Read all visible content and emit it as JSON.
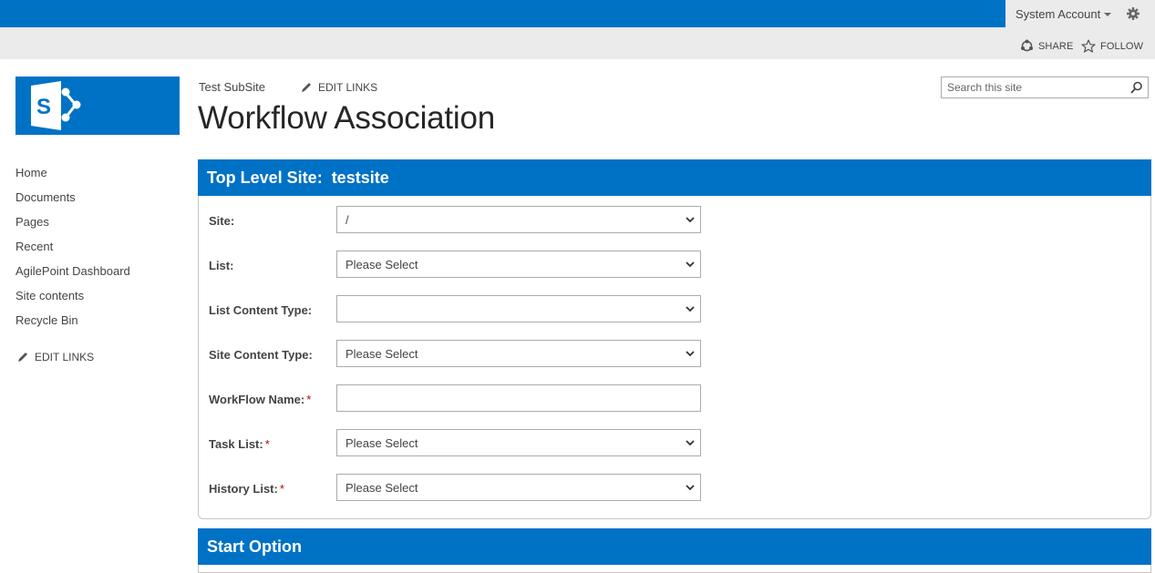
{
  "suite_bar": {
    "account_name": "System Account",
    "accent_color": "#0072c6"
  },
  "ribbon": {
    "share_label": "SHARE",
    "follow_label": "FOLLOW"
  },
  "header": {
    "site_link": "Test SubSite",
    "edit_links_label": "EDIT LINKS",
    "page_title": "Workflow Association",
    "search_placeholder": "Search this site"
  },
  "quick_launch": {
    "items": [
      {
        "label": "Home"
      },
      {
        "label": "Documents"
      },
      {
        "label": "Pages"
      },
      {
        "label": "Recent"
      },
      {
        "label": "AgilePoint Dashboard"
      },
      {
        "label": "Site contents"
      },
      {
        "label": "Recycle Bin"
      }
    ],
    "edit_links_label": "EDIT LINKS"
  },
  "association_panel": {
    "header_label": "Top Level Site:",
    "header_value": "testsite",
    "fields": [
      {
        "label": "Site:",
        "required": false,
        "type": "select",
        "value": "/"
      },
      {
        "label": "List:",
        "required": false,
        "type": "select",
        "value": "Please Select"
      },
      {
        "label": "List Content Type:",
        "required": false,
        "type": "select",
        "value": ""
      },
      {
        "label": "Site Content Type:",
        "required": false,
        "type": "select",
        "value": "Please Select"
      },
      {
        "label": "WorkFlow Name:",
        "required": true,
        "type": "text",
        "value": ""
      },
      {
        "label": "Task List:",
        "required": true,
        "type": "select",
        "value": "Please Select"
      },
      {
        "label": "History List:",
        "required": true,
        "type": "select",
        "value": "Please Select"
      }
    ],
    "required_marker": "*"
  },
  "start_option_panel": {
    "header_label": "Start Option"
  }
}
